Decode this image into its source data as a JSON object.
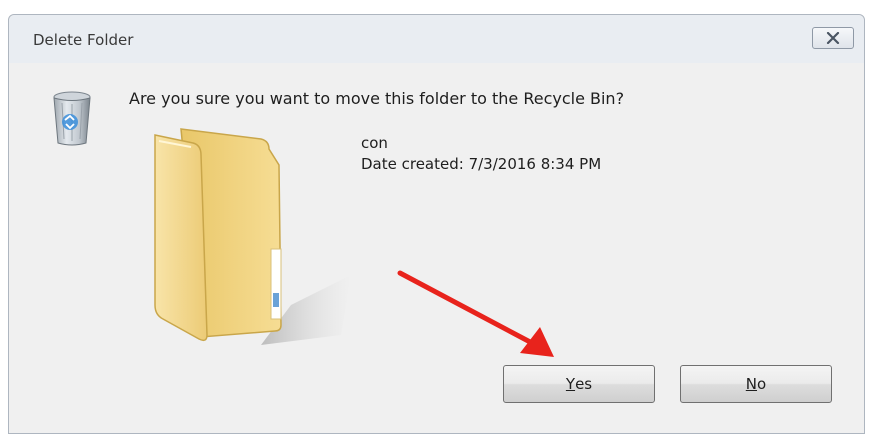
{
  "dialog": {
    "title": "Delete Folder",
    "question": "Are you sure you want to move this folder to the Recycle Bin?",
    "item": {
      "name": "con",
      "date_created": "Date created: 7/3/2016 8:34 PM"
    },
    "buttons": {
      "yes": {
        "accesskey": "Y",
        "rest": "es"
      },
      "no": {
        "accesskey": "N",
        "rest": "o"
      }
    },
    "icons": {
      "close": "close-icon",
      "recycle_bin": "recycle-bin-icon",
      "folder": "folder-icon",
      "annotation_arrow": "red-arrow"
    }
  },
  "colors": {
    "dialog_bg": "#f0f0f0",
    "titlebar_bg": "#e9edf2",
    "arrow": "#e8231c",
    "folder": "#f3d889"
  }
}
